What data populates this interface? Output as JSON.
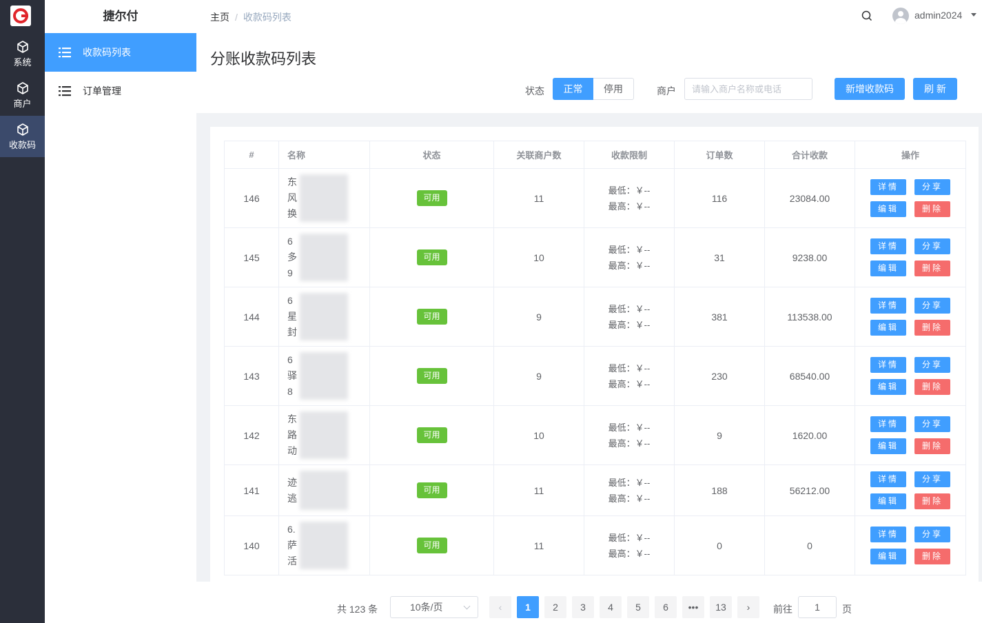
{
  "rail": {
    "items": [
      {
        "label": "系统",
        "icon": "cube-icon"
      },
      {
        "label": "商户",
        "icon": "cube-icon"
      },
      {
        "label": "收款码",
        "icon": "cube-icon"
      }
    ]
  },
  "sidebar": {
    "brand": "捷尔付",
    "items": [
      {
        "label": "收款码列表",
        "icon": "list-icon"
      },
      {
        "label": "订单管理",
        "icon": "list-icon"
      }
    ]
  },
  "header": {
    "breadcrumb_home": "主页",
    "breadcrumb_sep": "/",
    "breadcrumb_current": "收款码列表",
    "username": "admin2024"
  },
  "page": {
    "title": "分账收款码列表",
    "status_label": "状态",
    "status_on": "正常",
    "status_off": "停用",
    "merchant_label": "商户",
    "merchant_placeholder": "请输入商户名称或电话",
    "add_button": "新增收款码",
    "refresh_button": "刷 新"
  },
  "table": {
    "headers": [
      "#",
      "名称",
      "状态",
      "关联商户数",
      "收款限制",
      "订单数",
      "合计收款",
      "操作"
    ],
    "rows": [
      {
        "id": "146",
        "name": [
          "东",
          "风",
          "换"
        ],
        "status": "可用",
        "merchants": "11",
        "min": "最低：￥--",
        "max": "最高：￥--",
        "orders": "116",
        "total": "23084.00"
      },
      {
        "id": "145",
        "name": [
          "6",
          "多",
          "9"
        ],
        "status": "可用",
        "merchants": "10",
        "min": "最低：￥--",
        "max": "最高：￥--",
        "orders": "31",
        "total": "9238.00"
      },
      {
        "id": "144",
        "name": [
          "6",
          "星",
          "封"
        ],
        "status": "可用",
        "merchants": "9",
        "min": "最低：￥--",
        "max": "最高：￥--",
        "orders": "381",
        "total": "113538.00"
      },
      {
        "id": "143",
        "name": [
          "6",
          "驿",
          "8"
        ],
        "status": "可用",
        "merchants": "9",
        "min": "最低：￥--",
        "max": "最高：￥--",
        "orders": "230",
        "total": "68540.00"
      },
      {
        "id": "142",
        "name": [
          "东",
          "路",
          "动"
        ],
        "status": "可用",
        "merchants": "10",
        "min": "最低：￥--",
        "max": "最高：￥--",
        "orders": "9",
        "total": "1620.00"
      },
      {
        "id": "141",
        "name": [
          "迹",
          "逃"
        ],
        "status": "可用",
        "merchants": "11",
        "min": "最低：￥--",
        "max": "最高：￥--",
        "orders": "188",
        "total": "56212.00"
      },
      {
        "id": "140",
        "name": [
          "6.",
          "萨",
          "活"
        ],
        "status": "可用",
        "merchants": "11",
        "min": "最低：￥--",
        "max": "最高：￥--",
        "orders": "0",
        "total": "0"
      }
    ],
    "actions": {
      "detail": "详情",
      "share": "分享",
      "edit": "编辑",
      "delete": "删除"
    }
  },
  "pagination": {
    "total": "共 123 条",
    "page_size": "10条/页",
    "pages": [
      "1",
      "2",
      "3",
      "4",
      "5",
      "6",
      "•••",
      "13"
    ],
    "current": "1",
    "prev": "‹",
    "next": "›",
    "goto_label": "前往",
    "goto_value": "1",
    "goto_suffix": "页"
  },
  "colors": {
    "primary": "#409eff",
    "success": "#67c23a",
    "danger": "#f56c6c",
    "rail": "#2b2f3a"
  }
}
